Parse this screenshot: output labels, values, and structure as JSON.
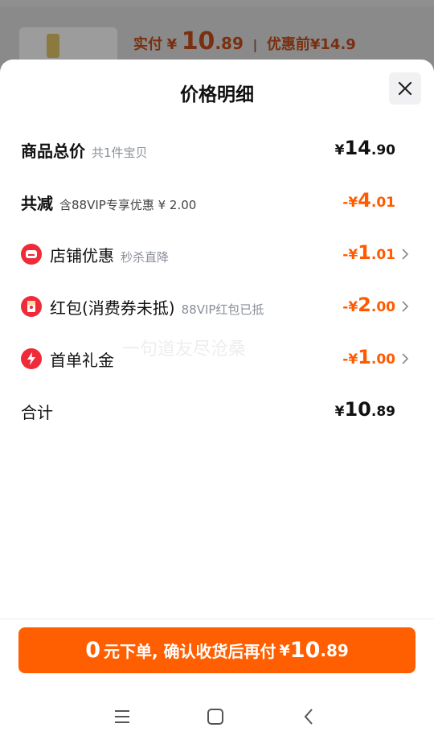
{
  "background": {
    "price_label": "实付",
    "price_yen": "¥",
    "price_int": "10",
    "price_dec": ".89",
    "separator": "|",
    "pre_price": "优惠前¥14.9"
  },
  "sheet": {
    "title": "价格明细",
    "close_icon": "close-icon"
  },
  "rows": {
    "total": {
      "label": "商品总价",
      "sub": "共1件宝贝",
      "yen": "¥",
      "int": "14",
      "dec": ".90"
    },
    "reduce": {
      "label": "共减",
      "sub": "含88VIP专享优惠 ¥ 2.00",
      "yen": "-¥",
      "int": "4",
      "dec": ".01"
    },
    "store": {
      "label": "店铺优惠",
      "sub": "秒杀直降",
      "yen": "-¥",
      "int": "1",
      "dec": ".01",
      "icon": "store-icon"
    },
    "redpacket": {
      "label": "红包(消费券未抵)",
      "sub": "88VIP红包已抵",
      "yen": "-¥",
      "int": "2",
      "dec": ".00",
      "icon": "red-packet-icon"
    },
    "firstorder": {
      "label": "首单礼金",
      "yen": "-¥",
      "int": "1",
      "dec": ".00",
      "icon": "lightning-icon"
    },
    "sum": {
      "label": "合计",
      "yen": "¥",
      "int": "10",
      "dec": ".89"
    }
  },
  "watermark": "一句道友尽沧桑",
  "cta": {
    "zero": "0",
    "text": "元下单, 确认收货后再付",
    "yen": "¥",
    "int": "10",
    "dec": ".89"
  },
  "colors": {
    "accent": "#ff5f00",
    "discount": "#ff5a00",
    "icon_red": "#ef2b3a"
  },
  "navigation": {
    "menu_icon": "menu-icon",
    "home_icon": "home-icon",
    "back_icon": "back-icon"
  }
}
